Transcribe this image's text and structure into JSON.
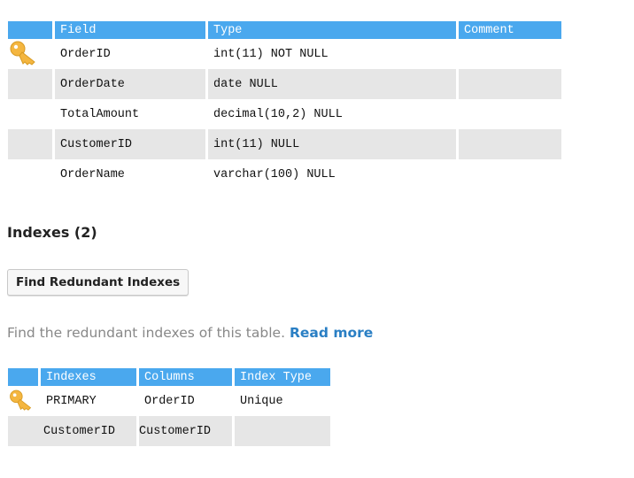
{
  "fields_table": {
    "headers": [
      "Field",
      "Type",
      "Comment"
    ],
    "rows": [
      {
        "field": "OrderID",
        "type": "int(11) NOT NULL",
        "comment": "",
        "primary_key": true
      },
      {
        "field": "OrderDate",
        "type": "date NULL",
        "comment": "",
        "primary_key": false
      },
      {
        "field": "TotalAmount",
        "type": "decimal(10,2) NULL",
        "comment": "",
        "primary_key": false
      },
      {
        "field": "CustomerID",
        "type": "int(11) NULL",
        "comment": "",
        "primary_key": false
      },
      {
        "field": "OrderName",
        "type": "varchar(100) NULL",
        "comment": "",
        "primary_key": false
      }
    ]
  },
  "indexes_section": {
    "heading": "Indexes (2)",
    "button_label": "Find Redundant Indexes",
    "description": "Find the redundant indexes of this table.",
    "read_more_label": "Read more"
  },
  "indexes_table": {
    "headers": [
      "Indexes",
      "Columns",
      "Index Type"
    ],
    "rows": [
      {
        "index": "PRIMARY",
        "columns": "OrderID",
        "index_type": "Unique",
        "primary_key": true
      },
      {
        "index": "CustomerID",
        "columns": "CustomerID",
        "index_type": "",
        "primary_key": false
      }
    ]
  },
  "colors": {
    "header_bg": "#4aa8ee",
    "alt_row_bg": "#e6e6e6",
    "link": "#2a7fc4",
    "key_icon": "#f4b640"
  },
  "icons": {
    "primary_key": "key-icon"
  }
}
